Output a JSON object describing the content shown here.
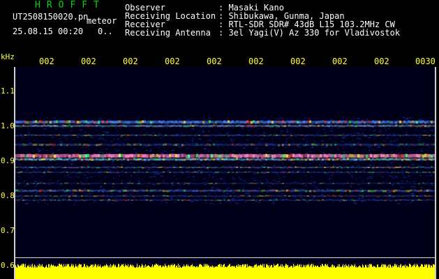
{
  "header": {
    "logo": "HROFFT",
    "filename": "UT2508150020.pn",
    "tag": "meteor",
    "datetime": "25.08.15 00:20",
    "small_value": "0.."
  },
  "metadata": [
    {
      "key": "Observer",
      "value": ": Masaki Kano"
    },
    {
      "key": "Receiving Location",
      "value": ": Shibukawa, Gunma, Japan"
    },
    {
      "key": "Receiver",
      "value": ": RTL-SDR SDR# 43dB L15 103.2MHz CW"
    },
    {
      "key": "Receiving Antenna",
      "value": ": 3el Yagi(V) Az 330 for Vladivostok"
    }
  ],
  "axes": {
    "y_unit": "kHz",
    "x_ticks": [
      "002",
      "002",
      "002",
      "002",
      "002",
      "002",
      "002",
      "002",
      "002",
      "0030"
    ],
    "y_ticks": [
      "1.1",
      "1.0",
      "0.9",
      "0.8",
      "0.7",
      "0.6"
    ]
  },
  "colors": {
    "accent_text": "#ffff40",
    "logo": "#00d800",
    "background": "#000000",
    "plot_bg": "#00001a",
    "power_bar": "#ffff00"
  }
}
